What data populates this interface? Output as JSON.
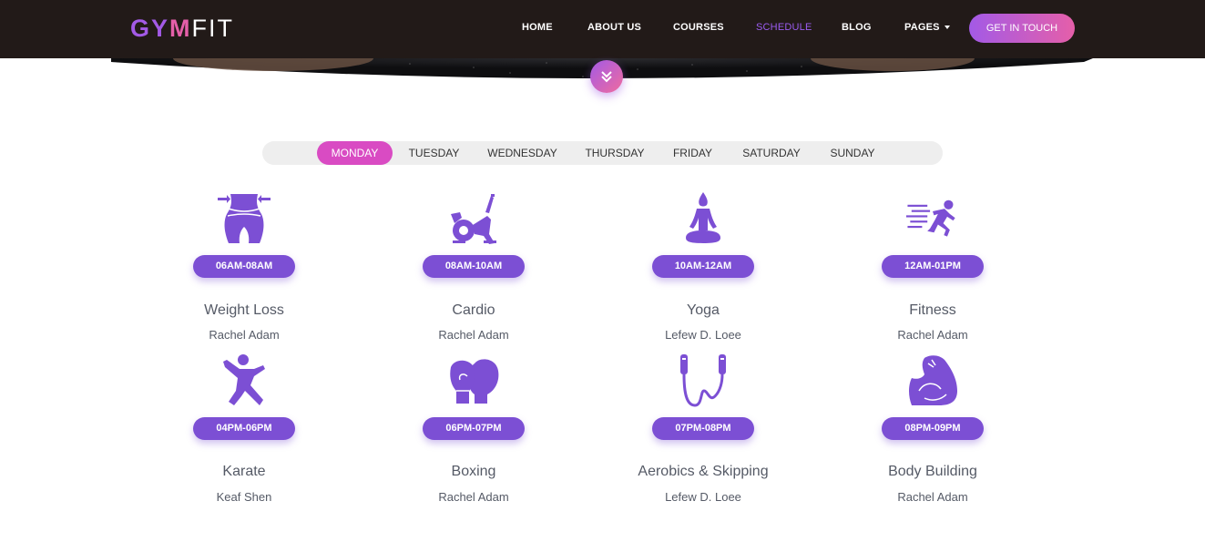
{
  "brand": {
    "part1": "GY",
    "part2": "M",
    "part3": "FIT"
  },
  "nav": {
    "items": [
      "HOME",
      "ABOUT US",
      "COURSES",
      "SCHEDULE",
      "BLOG",
      "PAGES"
    ],
    "active": "SCHEDULE",
    "cta": "GET IN TOUCH"
  },
  "colors": {
    "accent_purple": "#7c4fd4",
    "accent_pink": "#e55fa9",
    "header_bg": "#221a18",
    "tab_active": "#d94bc3"
  },
  "days": [
    "MONDAY",
    "TUESDAY",
    "WEDNESDAY",
    "THURSDAY",
    "FRIDAY",
    "SATURDAY",
    "SUNDAY"
  ],
  "active_day": "MONDAY",
  "classes": [
    {
      "time": "06AM-08AM",
      "name": "Weight Loss",
      "trainer": "Rachel Adam",
      "icon": "waist-icon"
    },
    {
      "time": "08AM-10AM",
      "name": "Cardio",
      "trainer": "Rachel Adam",
      "icon": "exercise-bike-icon"
    },
    {
      "time": "10AM-12AM",
      "name": "Yoga",
      "trainer": "Lefew D. Loee",
      "icon": "yoga-icon"
    },
    {
      "time": "12AM-01PM",
      "name": "Fitness",
      "trainer": "Rachel Adam",
      "icon": "runner-icon"
    },
    {
      "time": "04PM-06PM",
      "name": "Karate",
      "trainer": "Keaf Shen",
      "icon": "karate-icon"
    },
    {
      "time": "06PM-07PM",
      "name": "Boxing",
      "trainer": "Rachel Adam",
      "icon": "boxing-gloves-icon"
    },
    {
      "time": "07PM-08PM",
      "name": "Aerobics & Skipping",
      "trainer": "Lefew D. Loee",
      "icon": "jump-rope-icon"
    },
    {
      "time": "08PM-09PM",
      "name": "Body Building",
      "trainer": "Rachel Adam",
      "icon": "biceps-icon"
    }
  ]
}
